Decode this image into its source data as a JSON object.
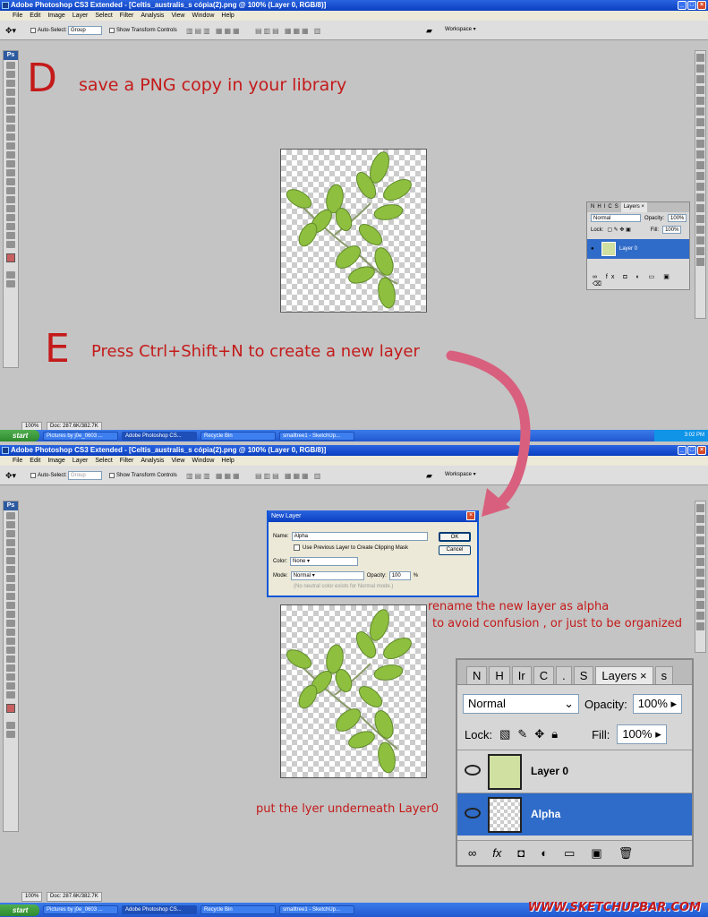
{
  "app": {
    "title": "Adobe Photoshop CS3 Extended - [Celtis_australis_s cópia(2).png @ 100% (Layer 0, RGB/8)]",
    "menu": [
      "File",
      "Edit",
      "Image",
      "Layer",
      "Select",
      "Filter",
      "Analysis",
      "View",
      "Window",
      "Help"
    ],
    "options": {
      "auto_select": "Auto-Select:",
      "group": "Group",
      "show_transform": "Show Transform Controls",
      "workspace": "Workspace ▾"
    },
    "toolbox_logo": "Ps",
    "status_zoom": "100%",
    "status_doc": "Doc: 287.6K/382.7K"
  },
  "taskbar": {
    "start": "start",
    "items": [
      "Pictures by j0e_0603 ...",
      "Adobe Photoshop CS...",
      "Recycle Bin",
      "smalltree1 - SketchUp..."
    ],
    "clock": "3:02 PM"
  },
  "steps": {
    "d_letter": "D",
    "d_text": "save a PNG copy in your library",
    "e_letter": "E",
    "e_text": "Press Ctrl+Shift+N to create a new layer",
    "rename_note_1": "rename the new layer as alpha",
    "rename_note_2": "to avoid confusion , or just to be organized",
    "underneath_note": "put the lyer underneath Layer0"
  },
  "mini_layers": {
    "tabs": [
      "N",
      "H",
      "I",
      "C",
      "S",
      "Layers ×"
    ],
    "mode": "Normal",
    "opacity_label": "Opacity:",
    "opacity": "100%",
    "lock_label": "Lock:",
    "fill_label": "Fill:",
    "fill": "100%",
    "layer": "Layer 0"
  },
  "dialog": {
    "title": "New Layer",
    "name_label": "Name:",
    "name_value": "Alpha",
    "clip_label": "Use Previous Layer to Create Clipping Mask",
    "color_label": "Color:",
    "color_value": "None",
    "mode_label": "Mode:",
    "mode_value": "Normal",
    "opacity_label": "Opacity:",
    "opacity_value": "100",
    "pct": "%",
    "neutral": "(No neutral color exists for Normal mode.)",
    "ok": "OK",
    "cancel": "Cancel"
  },
  "big_layers": {
    "tabs": [
      "N",
      "H",
      "Ir",
      "C",
      ".",
      "S",
      "Layers ×",
      "s"
    ],
    "mode": "Normal",
    "opacity_label": "Opacity:",
    "opacity": "100%",
    "lock_label": "Lock:",
    "fill_label": "Fill:",
    "fill": "100%",
    "layers": [
      "Layer 0",
      "Alpha"
    ],
    "footer_icons": [
      "link-icon",
      "fx-icon",
      "mask-icon",
      "adjustment-icon",
      "folder-icon",
      "new-layer-icon",
      "trash-icon"
    ]
  },
  "watermark": "WWW.SKETCHUPBAR.COM",
  "colors": {
    "annotation": "#c41a1a",
    "selection": "#2f6bc8",
    "xp_blue": "#2158d0"
  }
}
